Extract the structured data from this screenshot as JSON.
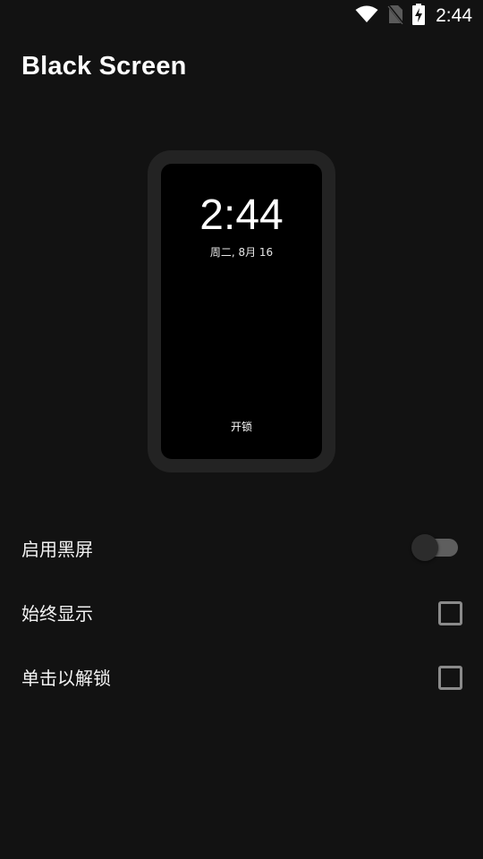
{
  "status_bar": {
    "time": "2:44",
    "icons": [
      "wifi-icon",
      "no-sim-icon",
      "battery-charging-icon"
    ]
  },
  "app": {
    "title": "Black Screen"
  },
  "preview": {
    "time": "2:44",
    "date": "周二, 8月 16",
    "unlock_label": "开锁"
  },
  "settings": [
    {
      "label": "启用黑屏",
      "control": "toggle",
      "checked": false
    },
    {
      "label": "始终显示",
      "control": "checkbox",
      "checked": false
    },
    {
      "label": "单击以解锁",
      "control": "checkbox",
      "checked": false
    }
  ]
}
